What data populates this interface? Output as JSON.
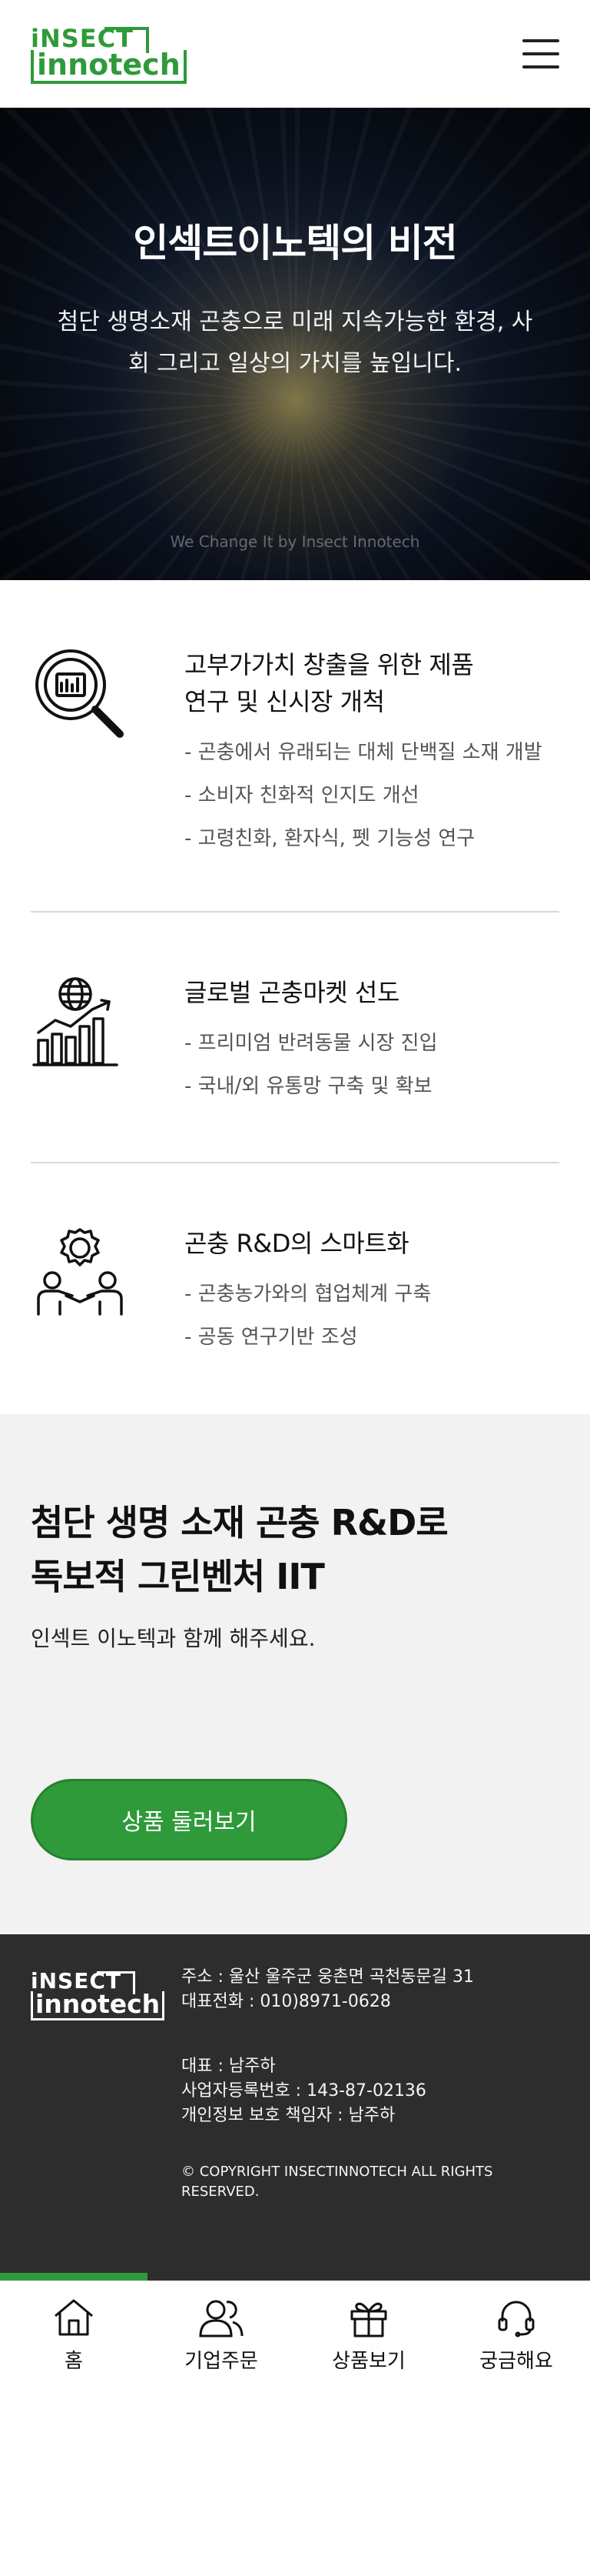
{
  "header": {
    "logo_top": "iNSECT",
    "logo_bottom": "innotech",
    "menu_icon": "hamburger-menu-icon"
  },
  "hero": {
    "title": "인섹트이노텍의 비전",
    "subtitle": "첨단 생명소재 곤충으로 미래 지속가능한 환경, 사회 그리고 일상의 가치를 높입니다.",
    "caption": "We Change It by Insect Innotech"
  },
  "features": [
    {
      "icon": "magnifier-chart-icon",
      "title_line1": "고부가가치 창출을 위한 제품",
      "title_line2": "연구 및 신시장 개척",
      "items": [
        "곤충에서 유래되는 대체 단백질 소재 개발",
        "소비자 친화적 인지도 개선",
        "고령친화, 환자식, 펫 기능성 연구"
      ]
    },
    {
      "icon": "globe-growth-chart-icon",
      "title_line1": "글로벌 곤충마켓 선도",
      "items": [
        "프리미엄 반려동물 시장 진입",
        "국내/외 유통망 구축 및 확보"
      ]
    },
    {
      "icon": "gear-collaboration-icon",
      "title_line1": "곤충 R&D의 스마트화",
      "items": [
        "곤충농가와의 협업체계 구축",
        "공동 연구기반 조성"
      ]
    }
  ],
  "promo": {
    "title_line1": "첨단 생명 소재 곤충 R&D로",
    "title_line2": "독보적 그린벤처 IIT",
    "text": "인섹트 이노텍과 함께 해주세요.",
    "button_label": "상품 둘러보기"
  },
  "footer": {
    "logo_top": "iNSECT",
    "logo_bottom": "innotech",
    "address": "주소 : 울산 울주군 웅촌면 곡천동문길 31",
    "phone": "대표전화 : 010)8971-0628",
    "ceo": "대표 : 남주하",
    "business_no": "사업자등록번호 : 143-87-02136",
    "privacy_officer": "개인정보 보호 책임자 : 남주하",
    "copyright": "© COPYRIGHT INSECTINNOTECH ALL RIGHTS RESERVED."
  },
  "bottom_nav": [
    {
      "label": "홈",
      "icon": "home-icon"
    },
    {
      "label": "기업주문",
      "icon": "users-icon"
    },
    {
      "label": "상품보기",
      "icon": "gift-icon"
    },
    {
      "label": "궁금해요",
      "icon": "headset-icon"
    }
  ],
  "colors": {
    "brand_green": "#2f9a3a",
    "footer_bg": "#2d2d2d",
    "promo_bg": "#f2f2f2"
  }
}
